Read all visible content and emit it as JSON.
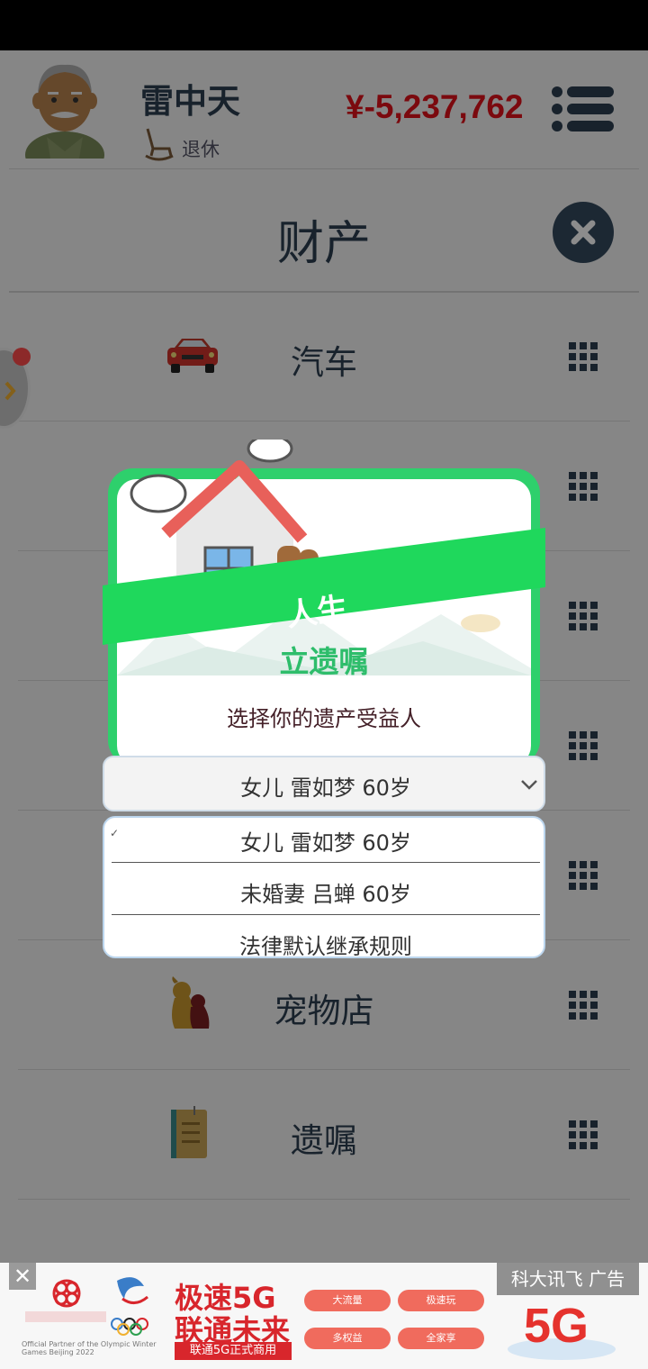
{
  "header": {
    "name": "雷中天",
    "status": "退休",
    "money": "¥-5,237,762"
  },
  "section": {
    "title": "财产"
  },
  "rows": [
    {
      "label": "汽车",
      "icon": "car-icon"
    },
    {
      "label": "",
      "icon": ""
    },
    {
      "label": "",
      "icon": ""
    },
    {
      "label": "",
      "icon": ""
    },
    {
      "label": "",
      "icon": ""
    },
    {
      "label": "宠物店",
      "icon": "dog-icon"
    },
    {
      "label": "遗嘱",
      "icon": "notebook-icon"
    }
  ],
  "dialog": {
    "banner": "人生",
    "heading": "立遗嘱",
    "subtitle": "选择你的遗产受益人",
    "selected": "女儿 雷如梦 60岁",
    "options": [
      "女儿 雷如梦 60岁",
      "未婚妻 吕蝉 60岁",
      "法律默认继承规则"
    ],
    "checked_index": 0
  },
  "ad": {
    "close": "✕",
    "headline_1": "极速5G",
    "headline_2": "联通未来",
    "bar": "联通5G正式商用",
    "pills": [
      "大流量",
      "极速玩",
      "多权益",
      "全家享"
    ],
    "corner": "科大讯飞 广告",
    "small": "Official Partner of the Olympic Winter Games Beijing 2022"
  },
  "colors": {
    "money": "#e1111a",
    "dialog_green": "#2ed06c",
    "heading_green": "#2ebd6b",
    "navy": "#2c3e50"
  }
}
